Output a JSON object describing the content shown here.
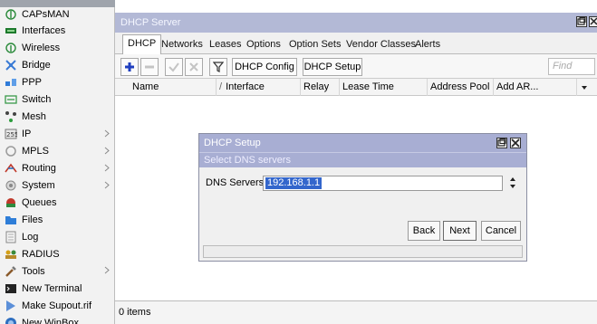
{
  "sidebar": {
    "items": [
      {
        "label": "CAPsMAN",
        "icon": "capsman-icon",
        "submenu": false
      },
      {
        "label": "Interfaces",
        "icon": "interfaces-icon",
        "submenu": false
      },
      {
        "label": "Wireless",
        "icon": "wireless-icon",
        "submenu": false
      },
      {
        "label": "Bridge",
        "icon": "bridge-icon",
        "submenu": false
      },
      {
        "label": "PPP",
        "icon": "ppp-icon",
        "submenu": false
      },
      {
        "label": "Switch",
        "icon": "switch-icon",
        "submenu": false
      },
      {
        "label": "Mesh",
        "icon": "mesh-icon",
        "submenu": false
      },
      {
        "label": "IP",
        "icon": "ip-icon",
        "submenu": true
      },
      {
        "label": "MPLS",
        "icon": "mpls-icon",
        "submenu": true
      },
      {
        "label": "Routing",
        "icon": "routing-icon",
        "submenu": true
      },
      {
        "label": "System",
        "icon": "system-icon",
        "submenu": true
      },
      {
        "label": "Queues",
        "icon": "queues-icon",
        "submenu": false
      },
      {
        "label": "Files",
        "icon": "files-icon",
        "submenu": false
      },
      {
        "label": "Log",
        "icon": "log-icon",
        "submenu": false
      },
      {
        "label": "RADIUS",
        "icon": "radius-icon",
        "submenu": false
      },
      {
        "label": "Tools",
        "icon": "tools-icon",
        "submenu": true
      },
      {
        "label": "New Terminal",
        "icon": "terminal-icon",
        "submenu": false
      },
      {
        "label": "Make Supout.rif",
        "icon": "supout-icon",
        "submenu": false
      },
      {
        "label": "New WinBox",
        "icon": "winbox-icon",
        "submenu": false
      }
    ]
  },
  "window": {
    "title": "DHCP Server",
    "tabs": [
      {
        "label": "DHCP",
        "active": true
      },
      {
        "label": "Networks",
        "active": false
      },
      {
        "label": "Leases",
        "active": false
      },
      {
        "label": "Options",
        "active": false
      },
      {
        "label": "Option Sets",
        "active": false
      },
      {
        "label": "Vendor Classes",
        "active": false
      },
      {
        "label": "Alerts",
        "active": false
      }
    ],
    "toolbar": {
      "dhcp_config_label": "DHCP Config",
      "dhcp_setup_label": "DHCP Setup",
      "find_placeholder": "Find"
    },
    "columns": [
      "Name",
      "Interface",
      "Relay",
      "Lease Time",
      "Address Pool",
      "Add AR..."
    ],
    "sort_indicator": "/",
    "status": "0 items"
  },
  "dialog": {
    "title": "DHCP Setup",
    "subtitle": "Select DNS servers",
    "dns_label": "DNS Servers:",
    "dns_value": "192.168.1.1",
    "back_label": "Back",
    "next_label": "Next",
    "cancel_label": "Cancel"
  },
  "colors": {
    "titlebar": "#b3b9d6",
    "dialog_title": "#a8aed3",
    "selection": "#3366cc",
    "add_icon": "#1f3fbf"
  }
}
